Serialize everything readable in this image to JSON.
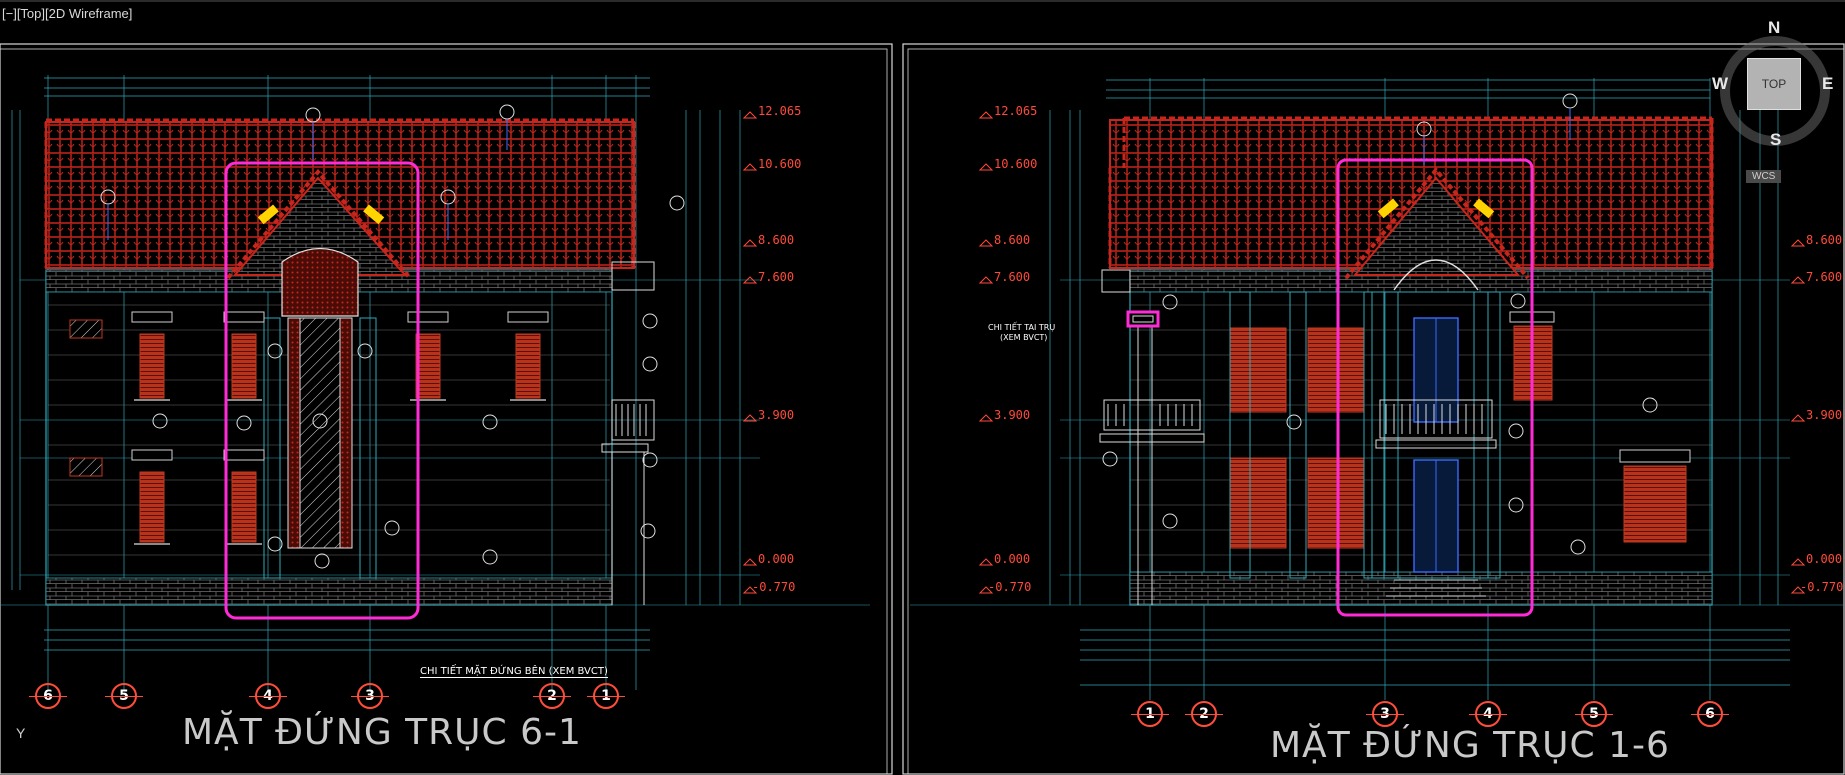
{
  "viewport": {
    "label": "[−][Top][2D Wireframe]"
  },
  "left_drawing": {
    "title": "MẶT ĐỨNG TRỤC 6-1",
    "note": "CHI TIẾT MẶT ĐỨNG BÊN (XEM BVCT)",
    "levels": [
      "12.065",
      "10.600",
      "8.600",
      "7.600",
      "3.900",
      "0.000",
      "-0.770"
    ],
    "grid_bubbles": [
      "6",
      "5",
      "4",
      "3",
      "2",
      "1"
    ]
  },
  "right_drawing": {
    "title": "MẶT ĐỨNG TRỤC 1-6",
    "note_line1": "CHI TIẾT TAI TRỤ",
    "note_line2": "(XEM BVCT)",
    "levels_left": [
      "12.065",
      "10.600",
      "8.600",
      "7.600",
      "3.900",
      "0.000",
      "-0.770"
    ],
    "levels_right": [
      "8.600",
      "7.600",
      "3.900",
      "0.000",
      "-0.770"
    ],
    "grid_bubbles": [
      "1",
      "2",
      "3",
      "4",
      "5",
      "6"
    ]
  },
  "viewcube": {
    "top": "TOP",
    "north": "N",
    "west": "W",
    "east": "E",
    "south": "S",
    "wcs": "WCS"
  },
  "ucs_axis": "Y",
  "colors": {
    "roof": "#c8261c",
    "highlight": "#ff2bd6",
    "wall": "#2fa8b8",
    "level": "#ff4a3a",
    "window": "#c0391f",
    "callout": "#ffd400"
  }
}
